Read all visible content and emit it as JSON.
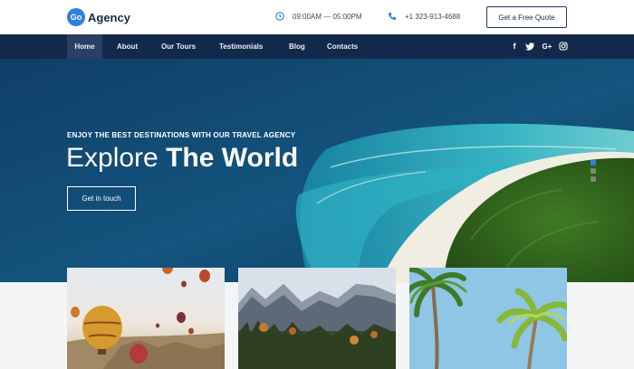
{
  "header": {
    "logo_badge": "Go",
    "logo_text": "Agency",
    "hours": "09:00AM — 05:00PM",
    "phone": "+1 323-913-4688",
    "cta_label": "Get a Free Quote",
    "icons": [
      "clock-icon",
      "phone-icon"
    ]
  },
  "nav": {
    "items": [
      "Home",
      "About",
      "Our Tours",
      "Testimonials",
      "Blog",
      "Contacts"
    ],
    "active": "Home",
    "social": {
      "facebook": "f",
      "twitter": "twitter-icon",
      "googleplus": "G+",
      "instagram": "instagram-icon"
    }
  },
  "hero": {
    "eyebrow": "ENJOY THE BEST DESTINATIONS WITH OUR TRAVEL AGENCY",
    "title_light": "Explore",
    "title_bold": "The World",
    "button_label": "Get in touch",
    "slides": 3,
    "active_slide": 1
  },
  "cards": [
    "hot-air-balloons-photo",
    "mountains-photo",
    "palm-trees-photo"
  ],
  "colors": {
    "brand_blue": "#2f7fe0",
    "nav_bg": "#13294b",
    "nav_active": "#2a3f63",
    "text_dark": "#1c2b44"
  }
}
